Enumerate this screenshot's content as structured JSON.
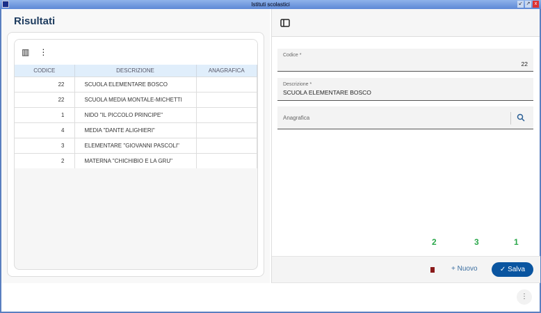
{
  "window": {
    "title": "Istituti scolastici"
  },
  "left": {
    "title": "Risultati",
    "columns": [
      "CODICE",
      "DESCRIZIONE",
      "ANAGRAFICA"
    ],
    "rows": [
      {
        "codice": "22",
        "descrizione": "SCUOLA ELEMENTARE BOSCO",
        "anagrafica": ""
      },
      {
        "codice": "22",
        "descrizione": "SCUOLA MEDIA MONTALE-MICHETTI",
        "anagrafica": ""
      },
      {
        "codice": "1",
        "descrizione": "NIDO \"IL PICCOLO PRINCIPE\"",
        "anagrafica": ""
      },
      {
        "codice": "4",
        "descrizione": "MEDIA \"DANTE ALIGHIERI\"",
        "anagrafica": ""
      },
      {
        "codice": "3",
        "descrizione": "ELEMENTARE \"GIOVANNI PASCOLI\"",
        "anagrafica": ""
      },
      {
        "codice": "2",
        "descrizione": "MATERNA \"CHICHIBIO E LA GRU\"",
        "anagrafica": ""
      }
    ]
  },
  "form": {
    "codice_label": "Codice *",
    "codice_value": "22",
    "descrizione_label": "Descrizione *",
    "descrizione_value": "SCUOLA ELEMENTARE BOSCO",
    "anagrafica_label": "Anagrafica"
  },
  "annotations": [
    "2",
    "3",
    "1"
  ],
  "footer": {
    "nuovo": "Nuovo",
    "salva": "Salva"
  }
}
